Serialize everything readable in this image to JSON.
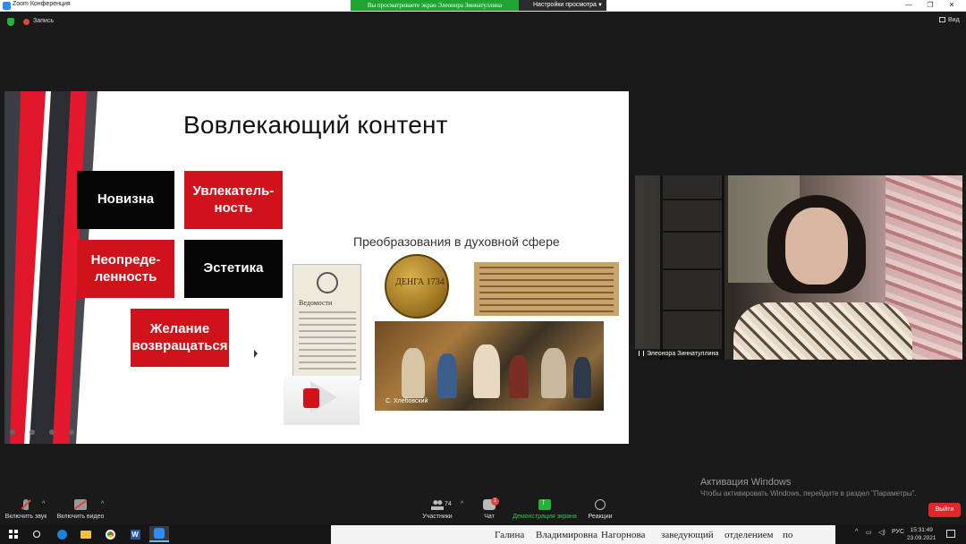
{
  "window": {
    "title": "Zoom Конференция",
    "share_banner": "Вы просматриваете экран Элеонора Зиннатуллина",
    "view_options": "Настройки просмотра"
  },
  "meeting": {
    "recording_label": "Запись",
    "view_label": "Вид"
  },
  "slide": {
    "title": "Вовлекающий контент",
    "boxes": [
      {
        "label": "Новизна",
        "style": "black"
      },
      {
        "label": "Увлекатель-\nность",
        "style": "red"
      },
      {
        "label": "Неопреде-\nленность",
        "style": "red"
      },
      {
        "label": "Эстетика",
        "style": "black"
      },
      {
        "label": "Желание\nвозвращаться",
        "style": "red"
      }
    ],
    "subtitle": "Преобразования  в духовной сфере",
    "doc_heading": "Ведомости",
    "coin_text": "ДЕНГА 1734",
    "painting_caption": "С. Хлебовский",
    "accent_color": "#d0121b"
  },
  "participant": {
    "name": "Элеонора Зиннатуллина"
  },
  "activation": {
    "title": "Активация Windows",
    "subtitle": "Чтобы активировать Windows, перейдите в раздел \"Параметры\"."
  },
  "toolbar": {
    "audio_label": "Включить звук",
    "video_label": "Включить видео",
    "participants_label": "Участники",
    "participants_count": "74",
    "chat_label": "Чат",
    "chat_badge": "1",
    "share_label": "Демонстрация экрана",
    "reactions_label": "Реакции",
    "end_label": "Выйти"
  },
  "taskbar": {
    "doc_words": [
      "Галина",
      "Владимировна",
      "Нагорнова",
      "заведующий",
      "отделением",
      "по"
    ],
    "language": "РУС",
    "time": "15:31:49",
    "date": "23.09.2021"
  }
}
